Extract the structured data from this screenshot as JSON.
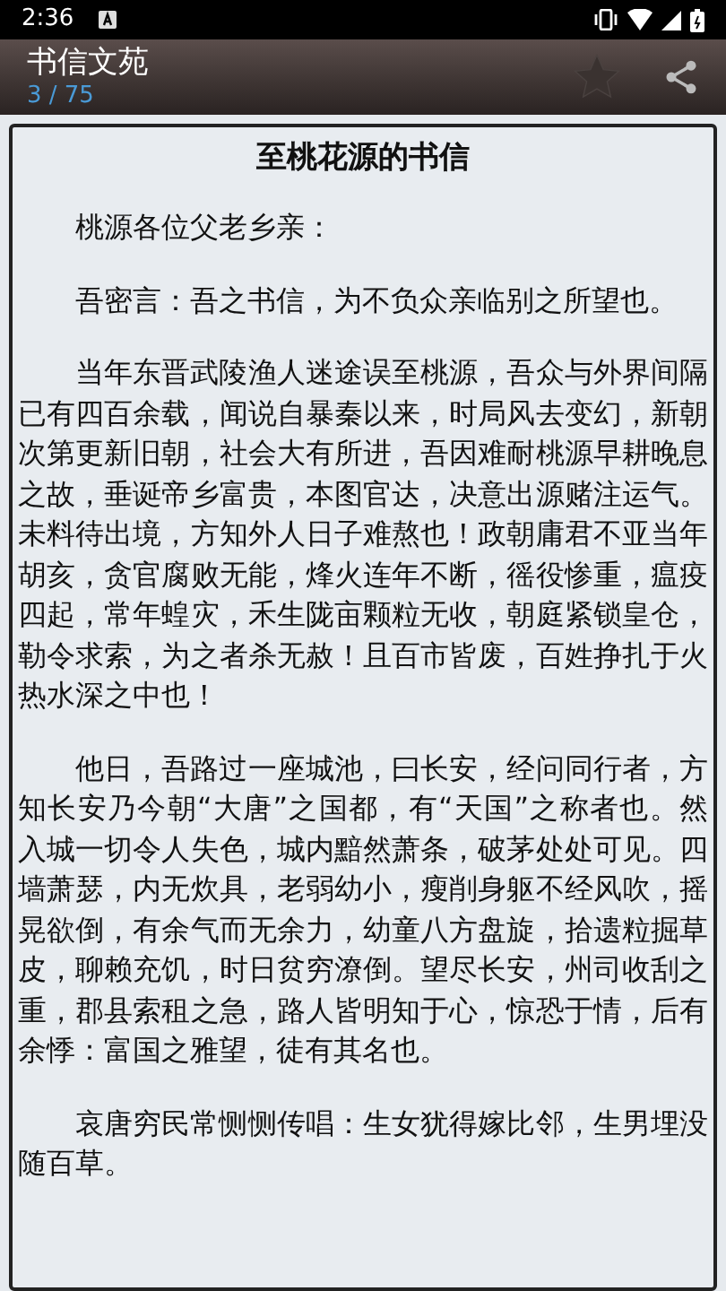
{
  "status_bar": {
    "time": "2:36"
  },
  "app_bar": {
    "title": "书信文苑",
    "page": "3 / 75",
    "starred": false
  },
  "letter": {
    "title": "至桃花源的书信",
    "paragraphs": [
      "桃源各位父老乡亲：",
      "吾密言：吾之书信，为不负众亲临别之所望也。",
      "当年东晋武陵渔人迷途误至桃源，吾众与外界间隔已有四百余载，闻说自暴秦以来，时局风去变幻，新朝次第更新旧朝，社会大有所进，吾因难耐桃源早耕晚息之故，垂诞帝乡富贵，本图官达，决意出源赌注运气。未料待出境，方知外人日子难熬也！政朝庸君不亚当年胡亥，贪官腐败无能，烽火连年不断，徭役惨重，瘟疫四起，常年蝗灾，禾生陇亩颗粒无收，朝庭紧锁皇仓，勒令求索，为之者杀无赦！且百市皆废，百姓挣扎于火热水深之中也！",
      "他日，吾路过一座城池，曰长安，经问同行者，方知长安乃今朝“大唐”之国都，有“天国”之称者也。然入城一切令人失色，城内黯然萧条，破茅处处可见。四墙萧瑟，内无炊具，老弱幼小，瘦削身躯不经风吹，摇晃欲倒，有余气而无余力，幼童八方盘旋，拾遗粒掘草皮，聊赖充饥，时日贫穷潦倒。望尽长安，州司收刮之重，郡县索租之急，路人皆明知于心，惊恐于情，后有余悸：富国之雅望，徒有其名也。",
      "哀唐穷民常恻恻传唱：生女犹得嫁比邻，生男埋没随百草。"
    ]
  }
}
